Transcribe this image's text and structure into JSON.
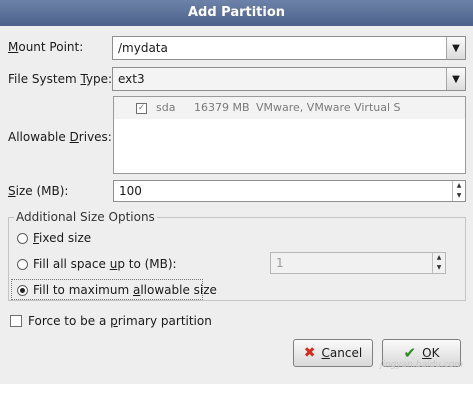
{
  "dialog": {
    "title": "Add Partition",
    "mount_point": {
      "label_pre": "",
      "label_key": "M",
      "label_post": "ount Point:",
      "value": "/mydata"
    },
    "fs_type": {
      "label_pre": "File System ",
      "label_key": "T",
      "label_post": "ype:",
      "value": "ext3"
    },
    "drives": {
      "label_pre": "Allowable ",
      "label_key": "D",
      "label_post": "rives:",
      "rows": [
        {
          "checked": true,
          "name": "sda",
          "size": "16379 MB",
          "model": "VMware, VMware Virtual S"
        }
      ]
    },
    "size": {
      "label_pre": "",
      "label_key": "S",
      "label_post": "ize (MB):",
      "value": "100"
    },
    "additional": {
      "title": "Additional Size Options",
      "fixed": {
        "label_pre": "",
        "label_key": "F",
        "label_post": "ixed size",
        "selected": false
      },
      "fill_up": {
        "label_pre": "Fill all space ",
        "label_key": "u",
        "label_post": "p to (MB):",
        "selected": false,
        "value": "1"
      },
      "fill_max": {
        "label_pre": "Fill to maximum ",
        "label_key": "a",
        "label_post": "llowable size",
        "selected": true
      }
    },
    "primary": {
      "label_pre": "Force to be a ",
      "label_key": "p",
      "label_post": "rimary partition",
      "checked": false
    },
    "buttons": {
      "cancel": "Cancel",
      "cancel_key": "C",
      "cancel_rest": "ancel",
      "ok": "OK",
      "ok_key": "O",
      "ok_rest": "K"
    }
  },
  "watermark": "jingyan.baidu.com",
  "icons": {
    "combo_arrow": "chevron-down-icon",
    "cancel": "red-x-icon",
    "ok": "green-check-icon"
  }
}
